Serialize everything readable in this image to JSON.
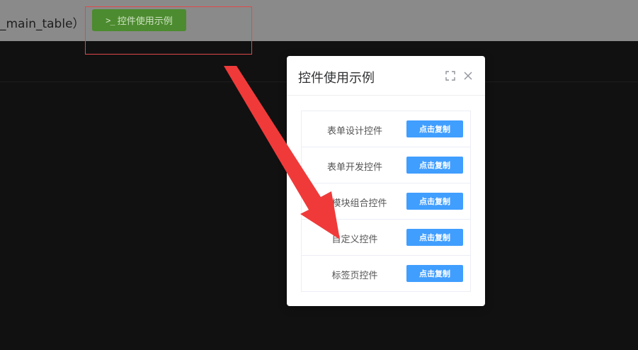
{
  "header": {
    "title": "_main_table）",
    "example_button": {
      "icon": "terminal-icon",
      "label": "控件使用示例"
    }
  },
  "modal": {
    "title": "控件使用示例",
    "expand_icon": "fullscreen-icon",
    "close_icon": "close-icon",
    "items": [
      {
        "label": "表单设计控件",
        "button": "点击复制"
      },
      {
        "label": "表单开发控件",
        "button": "点击复制"
      },
      {
        "label": "多模块组合控件",
        "button": "点击复制"
      },
      {
        "label": "自定义控件",
        "button": "点击复制"
      },
      {
        "label": "标签页控件",
        "button": "点击复制"
      }
    ]
  },
  "annotation": {
    "box_color": "#e0484a",
    "arrow_color": "#f03a3a"
  },
  "colors": {
    "primary": "#409eff",
    "example_button_bg": "#4c8b2f"
  }
}
